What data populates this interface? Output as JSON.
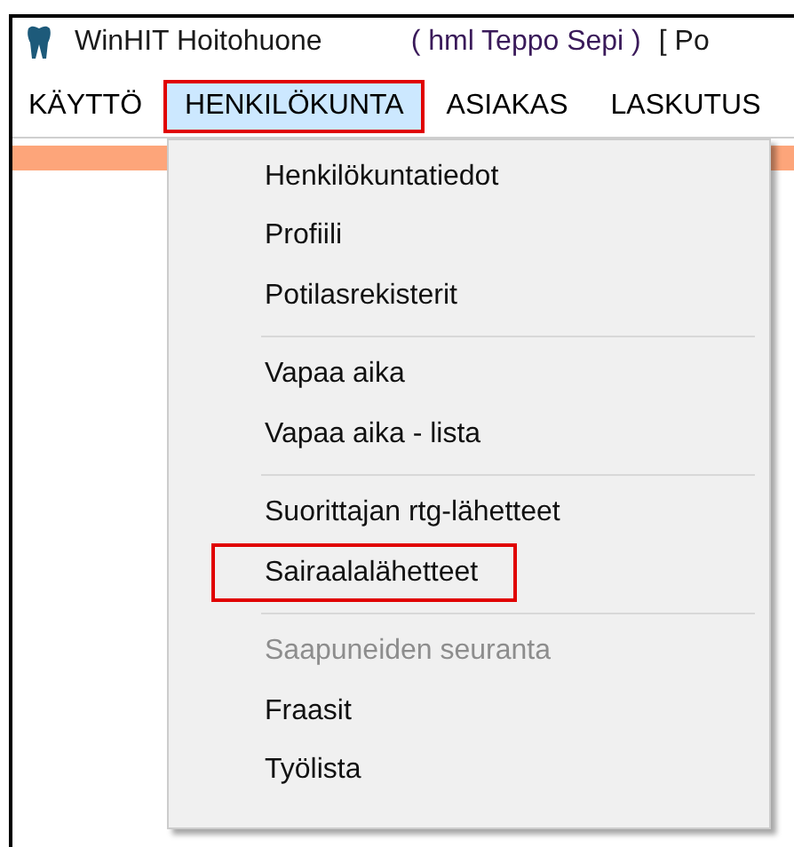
{
  "window": {
    "title": "WinHIT Hoitohuone",
    "user": "( hml Teppo Sepi )",
    "extra": "[ Po"
  },
  "menu_bar": [
    {
      "label": "KÄYTTÖ",
      "selected": false,
      "highlighted": false
    },
    {
      "label": "HENKILÖKUNTA",
      "selected": true,
      "highlighted": true
    },
    {
      "label": "ASIAKAS",
      "selected": false,
      "highlighted": false
    },
    {
      "label": "LASKUTUS",
      "selected": false,
      "highlighted": false
    }
  ],
  "menu": [
    {
      "kind": "item",
      "label": "Henkilökuntatiedot",
      "disabled": false,
      "highlighted": false
    },
    {
      "kind": "item",
      "label": "Profiili",
      "disabled": false,
      "highlighted": false
    },
    {
      "kind": "item",
      "label": "Potilasrekisterit",
      "disabled": false,
      "highlighted": false
    },
    {
      "kind": "separator"
    },
    {
      "kind": "item",
      "label": "Vapaa aika",
      "disabled": false,
      "highlighted": false
    },
    {
      "kind": "item",
      "label": "Vapaa aika - lista",
      "disabled": false,
      "highlighted": false
    },
    {
      "kind": "separator"
    },
    {
      "kind": "item",
      "label": "Suorittajan rtg-lähetteet",
      "disabled": false,
      "highlighted": false
    },
    {
      "kind": "item",
      "label": "Sairaalalähetteet",
      "disabled": false,
      "highlighted": true
    },
    {
      "kind": "separator"
    },
    {
      "kind": "item",
      "label": "Saapuneiden seuranta",
      "disabled": true,
      "highlighted": false
    },
    {
      "kind": "item",
      "label": "Fraasit",
      "disabled": false,
      "highlighted": false
    },
    {
      "kind": "item",
      "label": "Työlista",
      "disabled": false,
      "highlighted": false
    }
  ]
}
